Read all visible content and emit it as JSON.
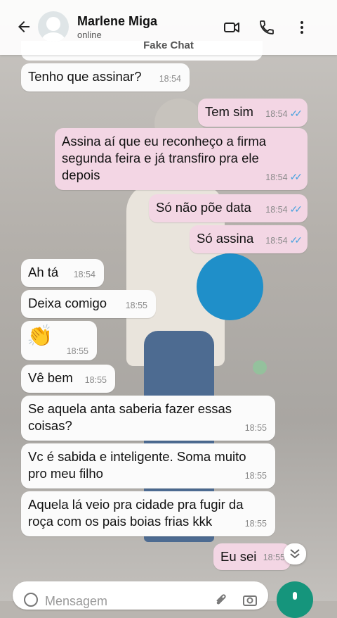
{
  "header": {
    "contact_name": "Marlene Miga",
    "status": "online",
    "watermark": "Fake Chat",
    "icons": [
      "back-arrow-icon",
      "video-call-icon",
      "phone-icon",
      "more-vert-icon"
    ]
  },
  "messages": [
    {
      "direction": "in",
      "text": "Tenho que assinar?",
      "time": "18:54"
    },
    {
      "direction": "out",
      "text": "Tem sim",
      "time": "18:54",
      "read": true
    },
    {
      "direction": "out",
      "text": "Assina aí que eu reconheço a firma segunda feira e já transfiro pra ele depois",
      "time": "18:54",
      "read": true
    },
    {
      "direction": "out",
      "text": "Só não põe data",
      "time": "18:54",
      "read": true
    },
    {
      "direction": "out",
      "text": "Só assina",
      "time": "18:54",
      "read": true
    },
    {
      "direction": "in",
      "text": "Ah tá",
      "time": "18:54"
    },
    {
      "direction": "in",
      "text": "Deixa comigo",
      "time": "18:55"
    },
    {
      "direction": "in",
      "text": "👏",
      "time": "18:55"
    },
    {
      "direction": "in",
      "text": "Vê bem",
      "time": "18:55"
    },
    {
      "direction": "in",
      "text": "Se aquela anta saberia fazer essas coisas?",
      "time": "18:55"
    },
    {
      "direction": "in",
      "text": "Vc é sabida e inteligente. Soma muito pro meu filho",
      "time": "18:55"
    },
    {
      "direction": "in",
      "text": "Aquela lá veio pra cidade pra fugir da roça com os pais boias frias kkk",
      "time": "18:55"
    },
    {
      "direction": "out",
      "text": "Eu sei",
      "time": "18:55"
    }
  ],
  "composer": {
    "placeholder": "Mensagem"
  },
  "colors": {
    "incoming_bubble": "#fbfbfb",
    "outgoing_bubble": "#f3d6e4",
    "read_ticks": "#4aa3df",
    "mic_button": "#15957c"
  }
}
